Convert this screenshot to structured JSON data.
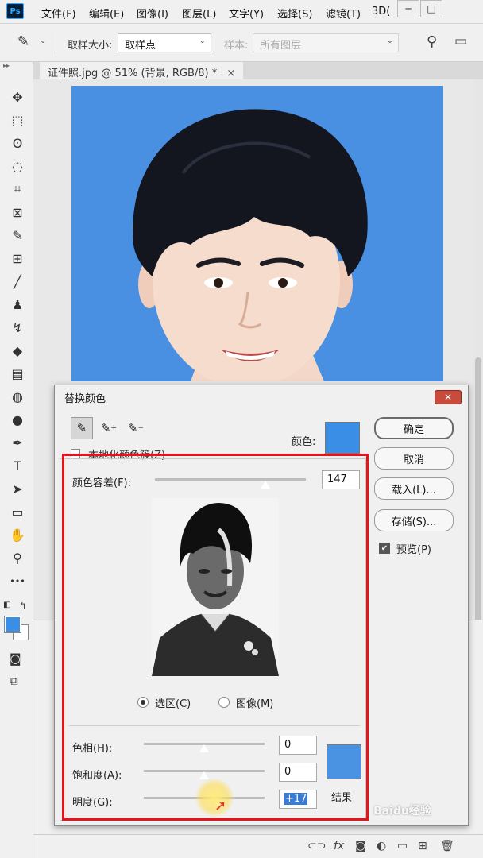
{
  "app": {
    "logo_text": "Ps"
  },
  "menu": [
    "文件(F)",
    "编辑(E)",
    "图像(I)",
    "图层(L)",
    "文字(Y)",
    "选择(S)",
    "滤镜(T)",
    "3D("
  ],
  "window_controls": {
    "minimize": "─",
    "restore": "□"
  },
  "options_bar": {
    "sample_size_label": "取样大小:",
    "sample_size_value": "取样点",
    "sample_label": "样本:",
    "sample_value": "所有图层"
  },
  "document_tab": {
    "title": "证件照.jpg @ 51% (背景, RGB/8) *",
    "close": "×"
  },
  "colors": {
    "photo_bg": "#4a90e2",
    "foreground": "#3a8ee6",
    "background": "#ffffff",
    "accent_red": "#e3141c"
  },
  "tools": [
    "move-icon",
    "marquee-icon",
    "lasso-icon",
    "quick-select-icon",
    "crop-icon",
    "frame-icon",
    "eyedropper-icon",
    "healing-icon",
    "brush-icon",
    "stamp-icon",
    "history-brush-icon",
    "eraser-icon",
    "gradient-icon",
    "blur-icon",
    "dodge-icon",
    "pen-icon",
    "type-icon",
    "path-select-icon",
    "rectangle-icon",
    "hand-icon",
    "zoom-icon",
    "more-icon"
  ],
  "tool_glyphs": [
    "✥",
    "⬚",
    "ʘ",
    "◌",
    "⌗",
    "⊠",
    "✎",
    "⊞",
    "╱",
    "♟",
    "↯",
    "◆",
    "▤",
    "◍",
    "●",
    "✒",
    "T",
    "➤",
    "▭",
    "✋",
    "⚲",
    "•••"
  ],
  "dialog": {
    "title": "替换颜色",
    "close": "✕",
    "color_label": "颜色:",
    "color": "#3a8ee6",
    "localized_label": "本地化颜色簇(Z)",
    "fuzziness_label": "颜色容差(F):",
    "fuzziness_value": "147",
    "fuzziness_fraction": 0.73,
    "selection_radio": "选区(C)",
    "image_radio": "图像(M)",
    "hue_label": "色相(H):",
    "hue_value": "0",
    "saturation_label": "饱和度(A):",
    "saturation_value": "0",
    "lightness_label": "明度(G):",
    "lightness_value": "+17",
    "result_label": "结果",
    "result_color": "#4a93e2",
    "buttons": {
      "ok": "确定",
      "cancel": "取消",
      "load": "载入(L)...",
      "save": "存储(S)..."
    },
    "preview_label": "预览(P)",
    "preview_checked": true
  },
  "watermark": "Baidu经验"
}
